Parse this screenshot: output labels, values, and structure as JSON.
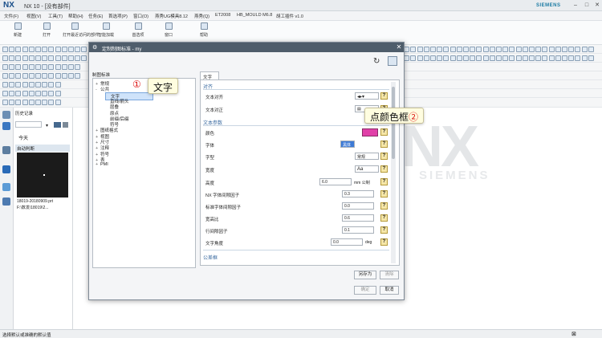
{
  "window": {
    "logo": "NX",
    "title": "NX 10 - [没有部件]",
    "brand": "SIEMENS"
  },
  "menu": [
    "文件(F)",
    "视图(V)",
    "工具(T)",
    "帮助(H)",
    "任务(E)",
    "首选项(P)",
    "窗口(O)",
    "燕秀UG模具8.12",
    "燕秀(Q)",
    "ET2008",
    "HB_MOULD M6.8",
    "胡工插件 v1.0"
  ],
  "ribbon": [
    {
      "label": "新建",
      "icon": "new-file-icon"
    },
    {
      "label": "打开",
      "icon": "open-folder-icon"
    },
    {
      "label": "打开最近访问的部件",
      "icon": "recent-icon"
    },
    {
      "label": "智能加载",
      "icon": "smart-load-icon"
    },
    {
      "label": "首选项",
      "icon": "preferences-icon"
    },
    {
      "label": "窗口",
      "icon": "window-icon"
    },
    {
      "label": "帮助",
      "icon": "help-icon"
    }
  ],
  "history": {
    "title": "历史记录",
    "today": "今天",
    "auto": "自动判断",
    "file_line1": "18019-20180909.prt",
    "file_line2": "F:\\数发\\18019\\2..."
  },
  "status": "选择默认或准确的默认值",
  "dialog": {
    "title": "定制制图标准 - my",
    "tree_label": "制图标准",
    "tree": [
      {
        "label": "常规",
        "indent": 0,
        "expander": "+"
      },
      {
        "label": "公共",
        "indent": 0,
        "expander": "-"
      },
      {
        "label": "文字",
        "indent": 1,
        "expander": "",
        "selected": true
      },
      {
        "label": "直线/箭头",
        "indent": 1,
        "expander": ""
      },
      {
        "label": "层叠",
        "indent": 1,
        "expander": ""
      },
      {
        "label": "原点",
        "indent": 1,
        "expander": ""
      },
      {
        "label": "前缀/后缀",
        "indent": 1,
        "expander": ""
      },
      {
        "label": "符号",
        "indent": 1,
        "expander": ""
      },
      {
        "label": "图纸格式",
        "indent": 0,
        "expander": "+"
      },
      {
        "label": "视图",
        "indent": 0,
        "expander": "+"
      },
      {
        "label": "尺寸",
        "indent": 0,
        "expander": "+"
      },
      {
        "label": "注释",
        "indent": 0,
        "expander": "+"
      },
      {
        "label": "符号",
        "indent": 0,
        "expander": "+"
      },
      {
        "label": "表",
        "indent": 0,
        "expander": "+"
      },
      {
        "label": "PMI",
        "indent": 0,
        "expander": "+"
      }
    ],
    "tab": "文字",
    "section_align": "对齐",
    "align_label": "文本对齐",
    "justify_label": "文本对正",
    "section_params": "文本参数",
    "color_label": "颜色",
    "font_label": "字体",
    "font_value": "黑体",
    "style_label": "字型",
    "style_value": "常规",
    "width_label": "宽度",
    "width_value": "Aa",
    "height_label": "高度",
    "height_value": "6.0",
    "height_unit": "mm 公制",
    "nx_gap_label": "NX 字体间隙因子",
    "nx_gap_value": "0.3",
    "std_gap_label": "标准字体间隙因子",
    "std_gap_value": "0.0",
    "aspect_label": "宽高比",
    "aspect_value": "0.6",
    "line_gap_label": "行间隙因子",
    "line_gap_value": "0.1",
    "angle_label": "文字角度",
    "angle_value": "0.0",
    "angle_unit": "deg",
    "section_tolerance": "公差框",
    "save_as": "另存为",
    "restore": "清除",
    "ok": "确定",
    "cancel": "取消",
    "accent": "#e040a8"
  },
  "callouts": {
    "c1_num": "①",
    "c1_text": "文字",
    "c2_text": "点颜色框",
    "c2_num": "②"
  },
  "canvas": {
    "logo": "NX",
    "sub": "SIEMENS"
  }
}
